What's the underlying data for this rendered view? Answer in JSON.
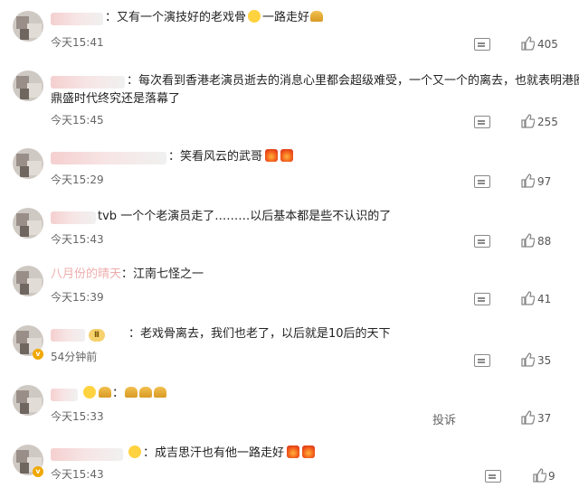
{
  "comments": [
    {
      "text": "：又有一个演技好的老戏骨",
      "suffix": "一路走好",
      "time": "今天15:41",
      "likes": "405"
    },
    {
      "text": "：每次看到香港老演员逝去的消息心里都会超级难受，一个又一个的离去，也就表明港圈",
      "text2": "鼎盛时代终究还是落幕了",
      "time": "今天15:45",
      "likes": "255"
    },
    {
      "text": "：笑看风云的武哥",
      "time": "今天15:29",
      "likes": "97"
    },
    {
      "prefix": "tvb",
      "text": "一个个老演员走了………以后基本都是些不认识的了",
      "time": "今天15:43",
      "likes": "88"
    },
    {
      "name_visible": "八月份的晴天",
      "text": "：江南七怪之一",
      "time": "今天15:39",
      "likes": "41"
    },
    {
      "badge": "Ⅱ",
      "text": "：老戏骨离去，我们也老了，以后就是10后的天下",
      "time": "54分钟前",
      "likes": "35"
    },
    {
      "text": "：",
      "time": "今天15:33",
      "report": "投诉",
      "likes": "37"
    },
    {
      "text": "：成吉思汗也有他一路走好",
      "time": "今天15:43",
      "likes": "9"
    }
  ]
}
